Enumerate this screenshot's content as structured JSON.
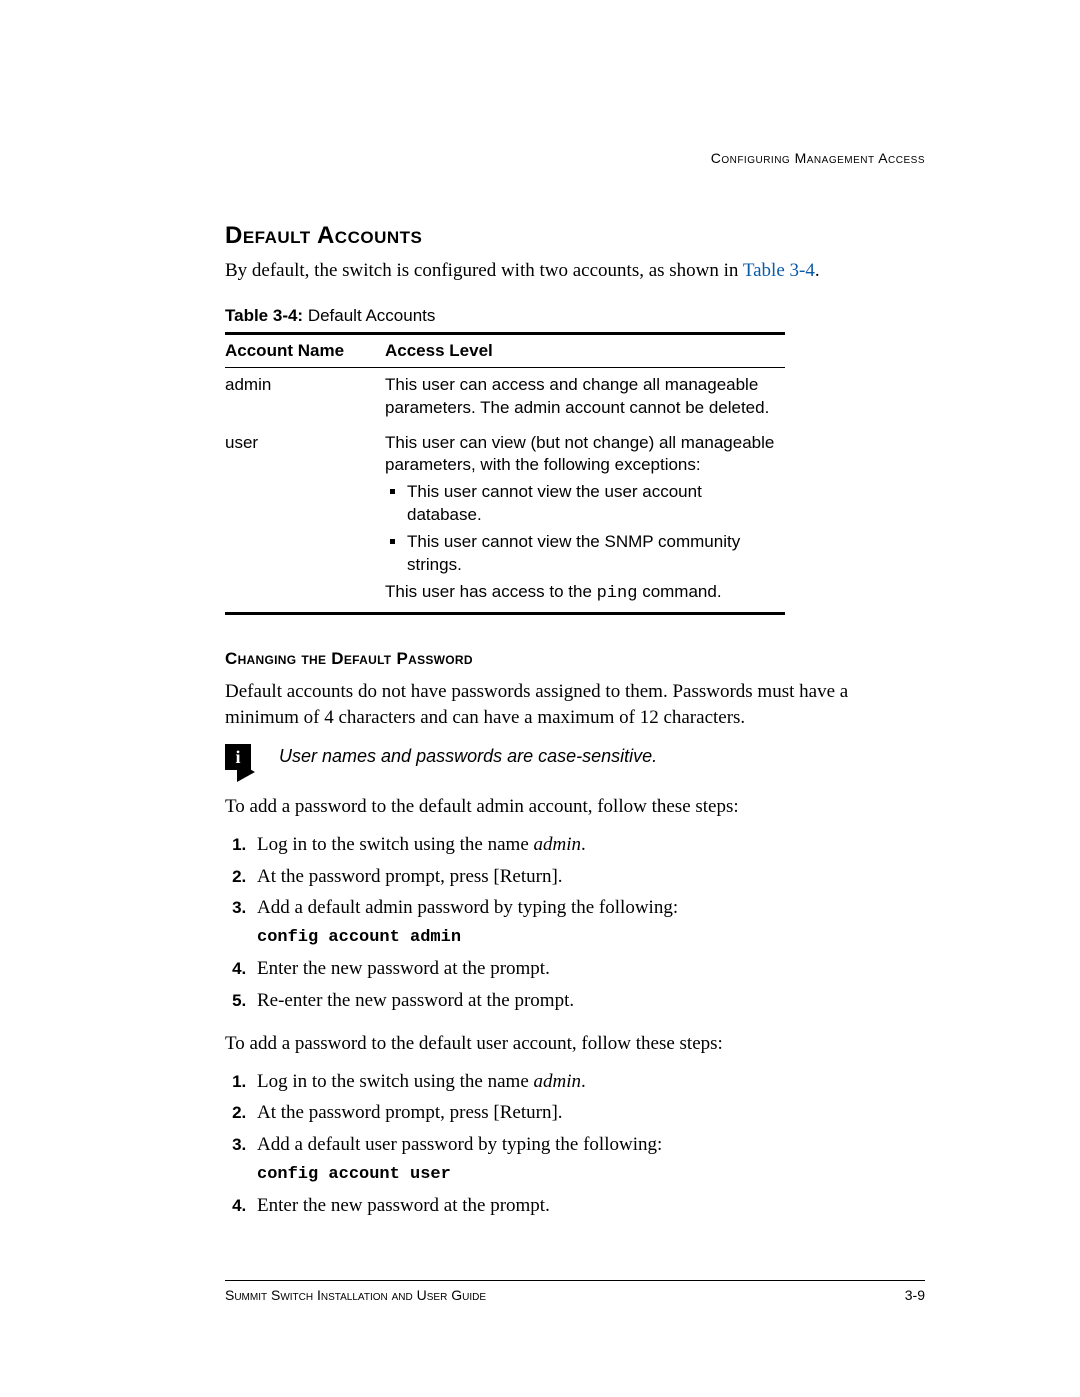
{
  "running_head": "Configuring Management Access",
  "section_title": "Default Accounts",
  "intro_prefix": "By default, the switch is configured with two accounts, as shown in ",
  "intro_link": "Table 3-4",
  "intro_suffix": ".",
  "table": {
    "label_bold": "Table 3-4:",
    "label_rest": "  Default Accounts",
    "headers": {
      "col1": "Account Name",
      "col2": "Access Level"
    },
    "rows": [
      {
        "name": "admin",
        "desc": "This user can access and change all manageable parameters. The admin account cannot be deleted."
      },
      {
        "name": "user",
        "desc": "This user can view (but not change) all manageable parameters, with the following exceptions:",
        "bullets": [
          "This user cannot view the user account database.",
          "This user cannot view the SNMP community strings."
        ],
        "after_pre": "This user has access to the ",
        "after_code": "ping",
        "after_post": " command."
      }
    ]
  },
  "subhead": "Changing the Default Password",
  "pwd_para": "Default accounts do not have passwords assigned to them. Passwords must have a minimum of 4 characters and can have a maximum of 12 characters.",
  "note": "User names and passwords are case-sensitive.",
  "admin_steps_intro": "To add a password to the default admin account, follow these steps:",
  "admin_steps": {
    "s1_pre": "Log in to the switch using the name ",
    "s1_name": "admin",
    "s1_post": ".",
    "s2": "At the password prompt, press [Return].",
    "s3": "Add a default admin password by typing the following:",
    "s3_cmd": "config account admin",
    "s4": "Enter the new password at the prompt.",
    "s5": "Re-enter the new password at the prompt."
  },
  "user_steps_intro": "To add a password to the default user account, follow these steps:",
  "user_steps": {
    "s1_pre": "Log in to the switch using the name ",
    "s1_name": "admin",
    "s1_post": ".",
    "s2": "At the password prompt, press [Return].",
    "s3": "Add a default user password by typing the following:",
    "s3_cmd": "config account user",
    "s4": "Enter the new password at the prompt."
  },
  "footer": {
    "left": "Summit Switch Installation and User Guide",
    "right": "3-9"
  }
}
